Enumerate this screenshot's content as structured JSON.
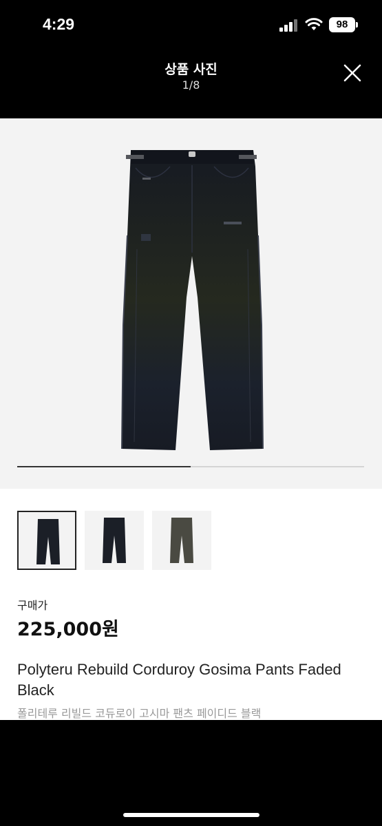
{
  "status_bar": {
    "time": "4:29",
    "battery": "98"
  },
  "header": {
    "title": "상품 사진",
    "counter": "1/8"
  },
  "gallery": {
    "progress": 0.5,
    "thumbnails": [
      {
        "selected": true,
        "color": "#1b1f27"
      },
      {
        "selected": false,
        "color": "#1b1f27"
      },
      {
        "selected": false,
        "color": "#4a4a42"
      }
    ]
  },
  "product": {
    "price_label": "구매가",
    "price": "225,000원",
    "name_en": "Polyteru Rebuild Corduroy Gosima Pants Faded Black",
    "name_ko": "폴리테루 리빌드 코듀로이 고시마 팬츠 페이디드 블랙"
  },
  "icons": {
    "close": "close-icon",
    "signal": "signal-icon",
    "wifi": "wifi-icon",
    "battery": "battery-icon"
  }
}
